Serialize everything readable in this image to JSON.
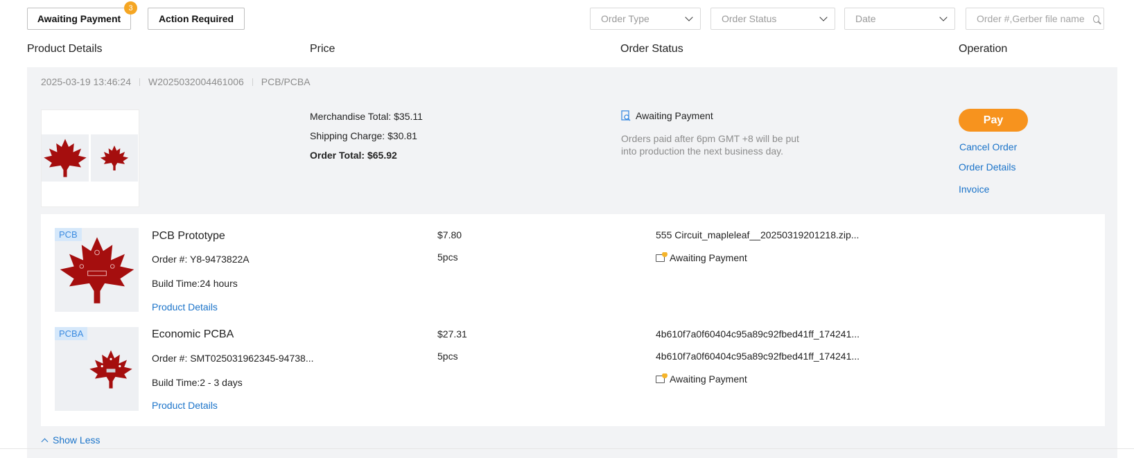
{
  "filters": {
    "awaiting_payment_label": "Awaiting Payment",
    "awaiting_payment_count": "3",
    "action_required_label": "Action Required"
  },
  "dropdowns": {
    "order_type": "Order Type",
    "order_status": "Order Status",
    "date": "Date"
  },
  "search": {
    "placeholder": "Order #,Gerber file name",
    "value": ""
  },
  "columns": {
    "product_details": "Product Details",
    "price": "Price",
    "order_status": "Order Status",
    "operation": "Operation"
  },
  "order": {
    "date": "2025-03-19 13:46:24",
    "number": "W2025032004461006",
    "category": "PCB/PCBA",
    "merchandise_total": "Merchandise Total: $35.11",
    "shipping_charge": "Shipping Charge: $30.81",
    "order_total": "Order Total: $65.92",
    "status": "Awaiting Payment",
    "note": "Orders paid after 6pm GMT +8 will be put into production the next business day.",
    "pay_label": "Pay",
    "cancel_label": "Cancel Order",
    "details_label": "Order Details",
    "invoice_label": "Invoice"
  },
  "items": [
    {
      "tag": "PCB",
      "name": "PCB Prototype",
      "order_no": "Order #: Y8-9473822A",
      "build_time": "Build Time:24 hours",
      "details_link": "Product Details",
      "price": "$7.80",
      "qty": "5pcs",
      "file1": "555 Circuit_mapleleaf__20250319201218.zip...",
      "status": "Awaiting Payment"
    },
    {
      "tag": "PCBA",
      "name": "Economic PCBA",
      "order_no": "Order #: SMT025031962345-94738...",
      "build_time": "Build Time:2 - 3 days",
      "details_link": "Product Details",
      "price": "$27.31",
      "qty": "5pcs",
      "file1": "4b610f7a0f60404c95a89c92fbed41ff_174241...",
      "file2": "4b610f7a0f60404c95a89c92fbed41ff_174241...",
      "status": "Awaiting Payment"
    }
  ],
  "show_less_label": "Show Less",
  "colors": {
    "accent": "#f7931e",
    "link": "#1a73c9",
    "pcb_red": "#a50e0e",
    "badge": "#f5a623"
  }
}
